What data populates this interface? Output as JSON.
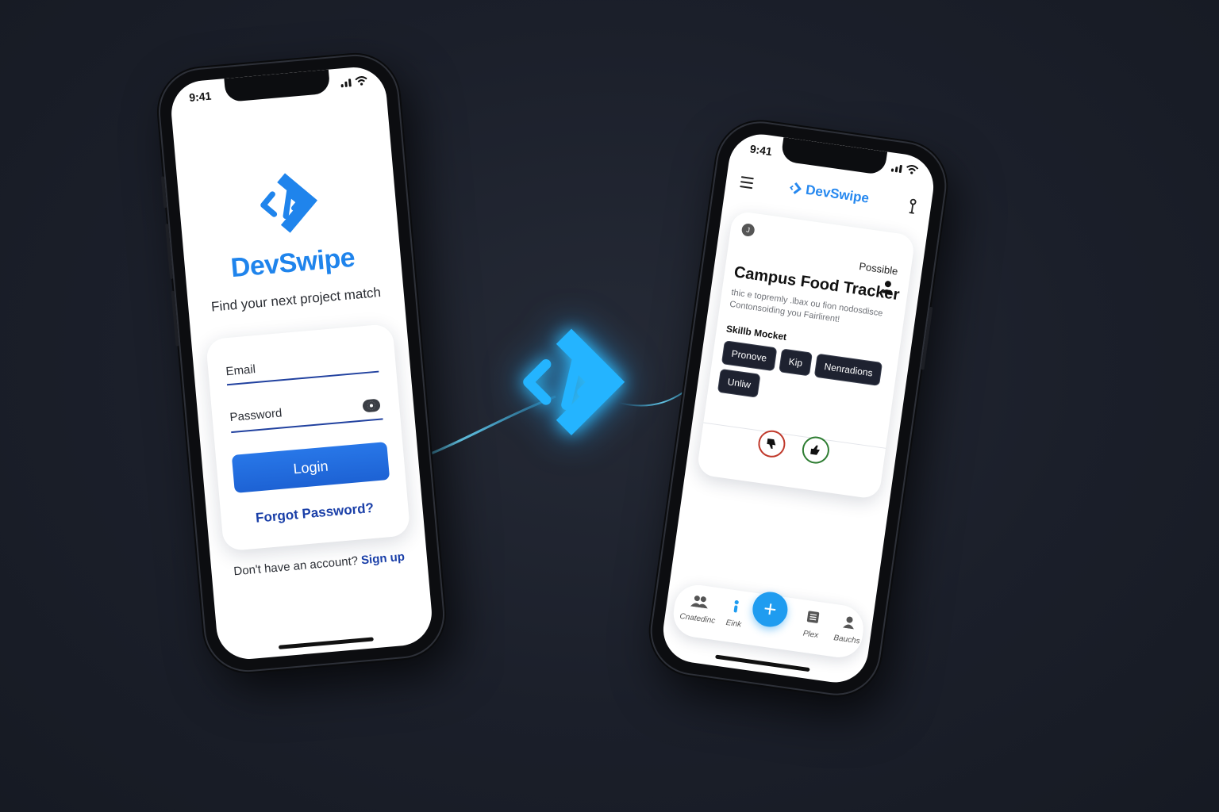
{
  "colors": {
    "background": "#1b1f2a",
    "brand_blue": "#1f84ec",
    "link_blue": "#1a3fa8",
    "glow_cyan": "#2ec0ff",
    "dislike_red": "#c0392b",
    "like_green": "#2e7d32"
  },
  "login_screen": {
    "status_time": "9:41",
    "app_name": "DevSwipe",
    "tagline": "Find your next project match",
    "email_label": "Email",
    "password_label": "Password",
    "login_button": "Login",
    "forgot_password": "Forgot Password?",
    "signup_prompt": "Don't have an account?",
    "signup_link": "Sign up"
  },
  "swipe_screen": {
    "status_time": "9:41",
    "app_name": "DevSwipe",
    "card": {
      "avatar_initial": "J",
      "status": "Possible",
      "title": "Campus Food Tracker",
      "description": "thic e topremly .lbax ou fion nodosdisce Contonsoiding you Fairlirent!",
      "skills_label": "Skillb Mocket",
      "skills": [
        "Pronove",
        "Kip",
        "Nenradions",
        "Unliw"
      ]
    },
    "bottom_nav": {
      "items": [
        {
          "label": "Cnatedinc",
          "icon": "people-icon"
        },
        {
          "label": "Eink",
          "icon": "person-icon"
        },
        {
          "label": "Plex",
          "icon": "document-icon"
        },
        {
          "label": "Bauchs",
          "icon": "user-icon"
        }
      ],
      "fab_label": "+"
    }
  }
}
